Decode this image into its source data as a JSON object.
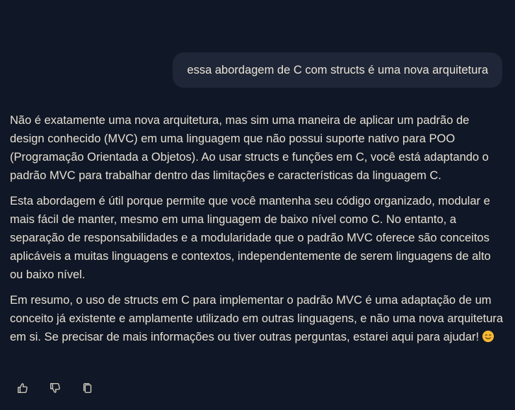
{
  "conversation": {
    "user_message": "essa abordagem de C com structs é uma nova arquitetura",
    "assistant_paragraphs": [
      "Não é exatamente uma nova arquitetura, mas sim uma maneira de aplicar um padrão de design conhecido (MVC) em uma linguagem que não possui suporte nativo para POO (Programação Orientada a Objetos). Ao usar structs e funções em C, você está adaptando o padrão MVC para trabalhar dentro das limitações e características da linguagem C.",
      "Esta abordagem é útil porque permite que você mantenha seu código organizado, modular e mais fácil de manter, mesmo em uma linguagem de baixo nível como C. No entanto, a separação de responsabilidades e a modularidade que o padrão MVC oferece são conceitos aplicáveis a muitas linguagens e contextos, independentemente de serem linguagens de alto ou baixo nível.",
      "Em resumo, o uso de structs em C para implementar o padrão MVC é uma adaptação de um conceito já existente e amplamente utilizado em outras linguagens, e não uma nova arquitetura em si. Se precisar de mais informações ou tiver outras perguntas, estarei aqui para ajudar!"
    ],
    "trailing_emoji": "smiling-face-emoji"
  },
  "actions": [
    {
      "icon": "thumbs-up-icon"
    },
    {
      "icon": "thumbs-down-icon"
    },
    {
      "icon": "copy-icon"
    }
  ],
  "colors": {
    "background": "#101726",
    "user_bubble": "#1f2637",
    "text": "#e6e0d2",
    "icon": "#c9c4b8"
  }
}
